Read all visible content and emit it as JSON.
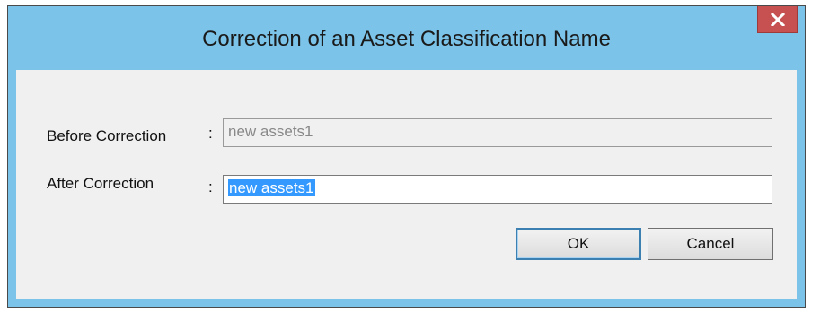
{
  "dialog": {
    "title": "Correction of an Asset Classification Name",
    "close_glyph": "x"
  },
  "form": {
    "before": {
      "label": "Before Correction",
      "colon": ":",
      "value": "new assets1"
    },
    "after": {
      "label": "After Correction",
      "colon": ":",
      "value": "new assets1"
    }
  },
  "buttons": {
    "ok_label": "OK",
    "cancel_label": "Cancel"
  },
  "colors": {
    "titlebar": "#7bc3e8",
    "close_button": "#c75050",
    "selection": "#3399ff"
  },
  "icons": {
    "close": "close-icon"
  }
}
